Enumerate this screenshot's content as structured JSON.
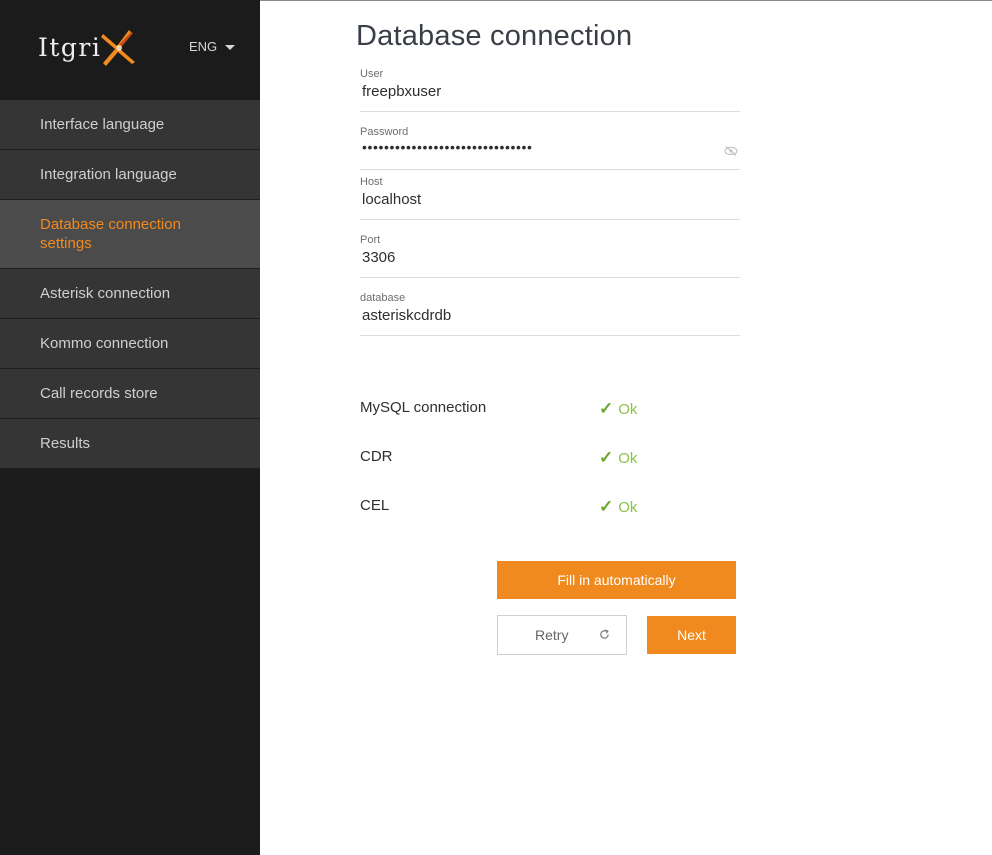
{
  "brand": {
    "logo_text": "Itgri",
    "language": "ENG"
  },
  "sidebar": {
    "items": [
      {
        "label": "Interface language",
        "active": false
      },
      {
        "label": "Integration language",
        "active": false
      },
      {
        "label": "Database connection settings",
        "active": true
      },
      {
        "label": "Asterisk connection",
        "active": false
      },
      {
        "label": "Kommo connection",
        "active": false
      },
      {
        "label": "Call records store",
        "active": false
      },
      {
        "label": "Results",
        "active": false
      }
    ]
  },
  "page": {
    "title": "Database connection"
  },
  "form": {
    "user": {
      "label": "User",
      "value": "freepbxuser"
    },
    "password": {
      "label": "Password",
      "value": "•••••••••••••••••••••••••••••••"
    },
    "host": {
      "label": "Host",
      "value": "localhost"
    },
    "port": {
      "label": "Port",
      "value": "3306"
    },
    "database": {
      "label": "database",
      "value": "asteriskcdrdb"
    }
  },
  "checks": [
    {
      "name": "MySQL connection",
      "status": "Ok"
    },
    {
      "name": "CDR",
      "status": "Ok"
    },
    {
      "name": "CEL",
      "status": "Ok"
    }
  ],
  "buttons": {
    "fill_auto": "Fill in automatically",
    "retry": "Retry",
    "next": "Next"
  },
  "colors": {
    "accent": "#f08a1e",
    "ok": "#8bc34a",
    "sidebar_bg": "#1b1b1b",
    "nav_bg": "#353535",
    "nav_active_bg": "#4b4b4b"
  },
  "icons": {
    "logo": "itgrix-x-logo",
    "caret": "chevron-down-icon",
    "eye": "eye-off-icon",
    "retry": "refresh-icon",
    "check": "check-icon"
  }
}
